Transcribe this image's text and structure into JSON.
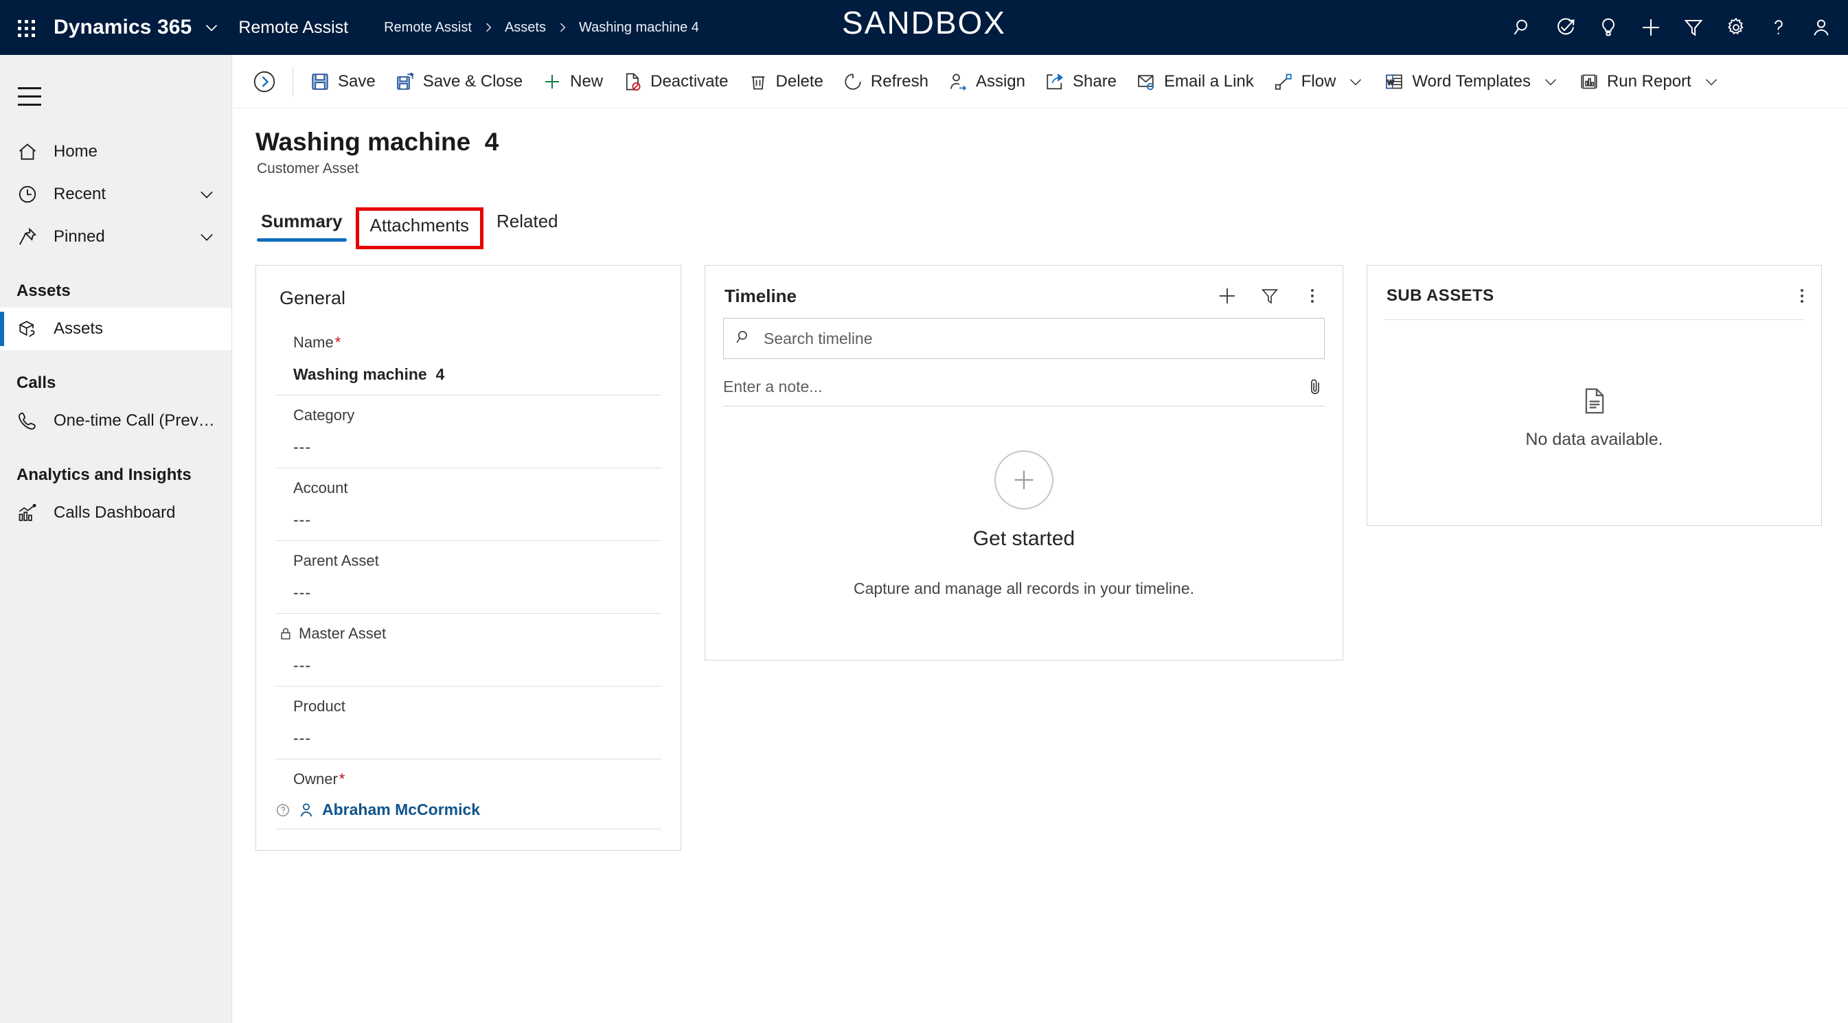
{
  "topbar": {
    "waffle_label": "app-launcher",
    "brand": "Dynamics 365",
    "app_name": "Remote Assist",
    "environment_banner": "SANDBOX",
    "breadcrumbs": [
      {
        "label": "Remote Assist"
      },
      {
        "label": "Assets"
      },
      {
        "label": "Washing machine 4"
      }
    ],
    "actions": [
      {
        "name": "search-icon",
        "label": "Search"
      },
      {
        "name": "diagnostics-icon",
        "label": "Diagnostics"
      },
      {
        "name": "lightbulb-icon",
        "label": "Insights"
      },
      {
        "name": "plus-icon",
        "label": "Quick create"
      },
      {
        "name": "filter-icon",
        "label": "Filters"
      },
      {
        "name": "gear-icon",
        "label": "Settings"
      },
      {
        "name": "help-icon",
        "label": "Help"
      },
      {
        "name": "user-avatar-icon",
        "label": "Account manager"
      }
    ]
  },
  "sidebar": {
    "hamburger_label": "Expand navigation",
    "items": [
      {
        "label": "Home",
        "icon": "home-icon",
        "chevron": false,
        "selected": false
      },
      {
        "label": "Recent",
        "icon": "clock-icon",
        "chevron": true,
        "selected": false
      },
      {
        "label": "Pinned",
        "icon": "pin-icon",
        "chevron": true,
        "selected": false
      }
    ],
    "groups": [
      {
        "title": "Assets",
        "items": [
          {
            "label": "Assets",
            "icon": "asset-box-icon",
            "selected": true
          }
        ]
      },
      {
        "title": "Calls",
        "items": [
          {
            "label": "One-time Call (Previe...",
            "icon": "phone-icon",
            "selected": false
          }
        ]
      },
      {
        "title": "Analytics and Insights",
        "items": [
          {
            "label": "Calls Dashboard",
            "icon": "chart-icon",
            "selected": false
          }
        ]
      }
    ]
  },
  "commandbar": {
    "back_label": "Show chart / collapse",
    "buttons": [
      {
        "label": "Save",
        "icon": "save-icon",
        "caret": false
      },
      {
        "label": "Save & Close",
        "icon": "save-close-icon",
        "caret": false
      },
      {
        "label": "New",
        "icon": "new-plus-icon",
        "caret": false
      },
      {
        "label": "Deactivate",
        "icon": "deactivate-icon",
        "caret": false
      },
      {
        "label": "Delete",
        "icon": "delete-trash-icon",
        "caret": false
      },
      {
        "label": "Refresh",
        "icon": "refresh-icon",
        "caret": false
      },
      {
        "label": "Assign",
        "icon": "assign-person-icon",
        "caret": false
      },
      {
        "label": "Share",
        "icon": "share-icon",
        "caret": false
      },
      {
        "label": "Email a Link",
        "icon": "email-link-icon",
        "caret": false
      },
      {
        "label": "Flow",
        "icon": "flow-icon",
        "caret": true
      },
      {
        "label": "Word Templates",
        "icon": "word-templates-icon",
        "caret": true
      },
      {
        "label": "Run Report",
        "icon": "run-report-icon",
        "caret": true
      }
    ]
  },
  "record": {
    "title": "Washing machine  4",
    "subtitle": "Customer Asset",
    "tabs": [
      {
        "label": "Summary",
        "active": true,
        "annotated": false
      },
      {
        "label": "Attachments",
        "active": false,
        "annotated": true
      },
      {
        "label": "Related",
        "active": false,
        "annotated": false
      }
    ],
    "annotation_color": "#e60000"
  },
  "general": {
    "section_title": "General",
    "fields": [
      {
        "label": "Name",
        "required": true,
        "locked": false,
        "value": "Washing machine  4",
        "bold": true
      },
      {
        "label": "Category",
        "required": false,
        "locked": false,
        "value": "---",
        "bold": false
      },
      {
        "label": "Account",
        "required": false,
        "locked": false,
        "value": "---",
        "bold": false
      },
      {
        "label": "Parent Asset",
        "required": false,
        "locked": false,
        "value": "---",
        "bold": false
      },
      {
        "label": "Master Asset",
        "required": false,
        "locked": true,
        "value": "---",
        "bold": false
      },
      {
        "label": "Product",
        "required": false,
        "locked": false,
        "value": "---",
        "bold": false
      }
    ],
    "owner": {
      "label": "Owner",
      "required": true,
      "value": "Abraham McCormick",
      "link_color": "#0f548c"
    }
  },
  "timeline": {
    "title": "Timeline",
    "icons": [
      {
        "name": "add-timeline-icon",
        "label": "Create a timeline record"
      },
      {
        "name": "filter-icon",
        "label": "Filter timeline"
      },
      {
        "name": "more-commands-icon",
        "label": "More commands"
      }
    ],
    "search_placeholder": "Search timeline",
    "search_value": "",
    "note_placeholder": "Enter a note...",
    "attach_icon_label": "Add attachment",
    "empty_heading": "Get started",
    "empty_text": "Capture and manage all records in your timeline."
  },
  "sub_assets": {
    "title": "SUB ASSETS",
    "more_label": "More commands",
    "empty_text": "No data available."
  },
  "colors": {
    "topbar_bg": "#001c3e",
    "accent_blue": "#0f6cbd",
    "link_blue": "#0f548c",
    "required_red": "#c50f1f",
    "annotation_red": "#e60000",
    "sidebar_bg": "#eff0f0"
  }
}
